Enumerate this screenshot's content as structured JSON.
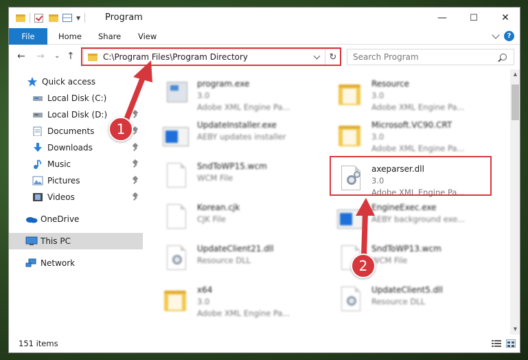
{
  "window": {
    "title": "Program",
    "controls": {
      "minimize": "—",
      "maximize": "☐",
      "close": "✕"
    }
  },
  "ribbon": {
    "tabs": [
      "File",
      "Home",
      "Share",
      "View"
    ]
  },
  "navigation": {
    "back": "←",
    "forward": "→",
    "recent": "⌄",
    "up": "↑",
    "address": "C:\\Program Files\\Program Directory",
    "refresh": "↻",
    "search_placeholder": "Search Program"
  },
  "sidebar": {
    "items": [
      {
        "label": "Quick access",
        "icon": "star-icon",
        "pinned": false
      },
      {
        "label": "Local Disk (C:)",
        "icon": "drive-icon",
        "pinned": true
      },
      {
        "label": "Local Disk (D:)",
        "icon": "drive-icon",
        "pinned": true
      },
      {
        "label": "Documents",
        "icon": "documents-icon",
        "pinned": true
      },
      {
        "label": "Downloads",
        "icon": "download-icon",
        "pinned": true
      },
      {
        "label": "Music",
        "icon": "music-icon",
        "pinned": true
      },
      {
        "label": "Pictures",
        "icon": "pictures-icon",
        "pinned": true
      },
      {
        "label": "Videos",
        "icon": "videos-icon",
        "pinned": true
      },
      {
        "label": "OneDrive",
        "icon": "cloud-icon",
        "pinned": false
      },
      {
        "label": "This PC",
        "icon": "pc-icon",
        "pinned": false,
        "selected": true
      },
      {
        "label": "Network",
        "icon": "network-icon",
        "pinned": false
      }
    ]
  },
  "files": [
    {
      "name": "program.exe",
      "line2": "3.0",
      "line3": "Adobe XML Engine Pa...",
      "icon": "exe-icon"
    },
    {
      "name": "Resource",
      "line2": "3.0",
      "line3": "Adobe XML Engine Pa...",
      "icon": "folder-icon"
    },
    {
      "name": "UpdateInstaller.exe",
      "line2": "AEBY updates installer",
      "line3": "",
      "icon": "app-icon"
    },
    {
      "name": "Microsoft.VC90.CRT",
      "line2": "3.0",
      "line3": "Adobe XML Engine Pa...",
      "icon": "folder-icon"
    },
    {
      "name": "SndToWP15.wcm",
      "line2": "WCM File",
      "line3": "",
      "icon": "document-icon"
    },
    {
      "name": "axeparser.dll",
      "line2": "3.0",
      "line3": "Adobe XML Engine Pa...",
      "icon": "dll-gear-icon",
      "highlighted": true
    },
    {
      "name": "Korean.cjk",
      "line2": "CJK File",
      "line3": "",
      "icon": "document-icon"
    },
    {
      "name": "EngineExec.exe",
      "line2": "AEBY background exe...",
      "line3": "",
      "icon": "app-icon"
    },
    {
      "name": "UpdateClient21.dll",
      "line2": "Resource DLL",
      "line3": "",
      "icon": "dll-gear-icon"
    },
    {
      "name": "SndToWP13.wcm",
      "line2": "WCM File",
      "line3": "",
      "icon": "document-icon"
    },
    {
      "name": "x64",
      "line2": "3.0",
      "line3": "Adobe XML Engine Pa...",
      "icon": "folder-icon"
    },
    {
      "name": "UpdateClient5.dll",
      "line2": "Resource DLL",
      "line3": "",
      "icon": "dll-gear-icon"
    }
  ],
  "annotations": {
    "step1": "1",
    "step2": "2",
    "highlight_color": "#d6373d"
  },
  "status": {
    "item_count": "151 items"
  },
  "colors": {
    "accent": "#1979ca",
    "selection": "#d9d9d9"
  }
}
